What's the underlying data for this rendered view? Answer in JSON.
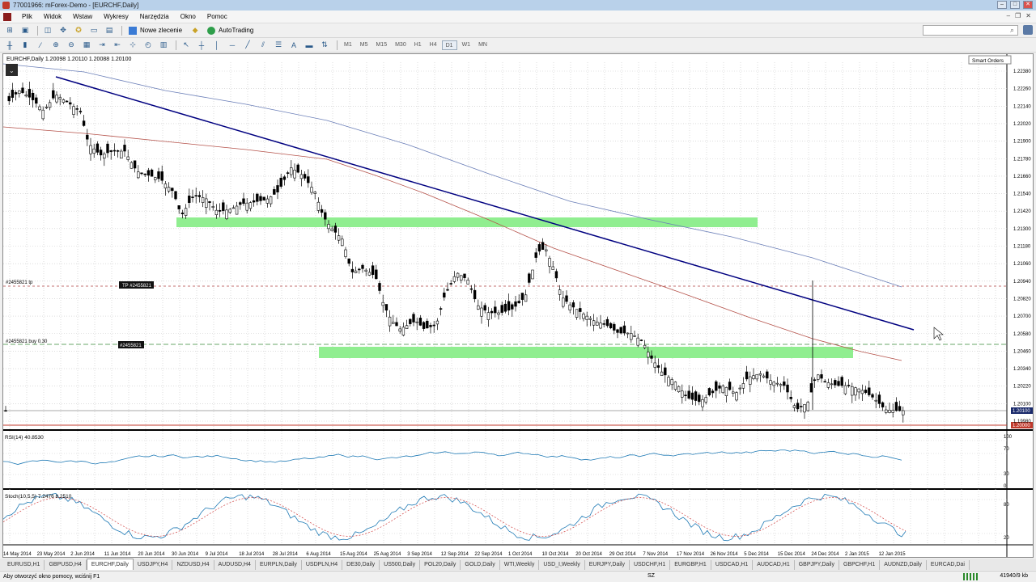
{
  "window": {
    "title": "77001966: mForex-Demo - [EURCHF,Daily]"
  },
  "menu": {
    "items": [
      "Plik",
      "Widok",
      "Wstaw",
      "Wykresy",
      "Narzędzia",
      "Okno",
      "Pomoc"
    ]
  },
  "toolbar": {
    "new_order_label": "Nowe zlecenie",
    "autotrading_label": "AutoTrading"
  },
  "timeframes": [
    "M1",
    "M5",
    "M15",
    "M30",
    "H1",
    "H4",
    "D1",
    "W1",
    "MN"
  ],
  "active_timeframe": "D1",
  "chart": {
    "info": "EURCHF,Daily  1.20098 1.20110 1.20088 1.20100",
    "smart_orders": "Smart Orders",
    "price_labels": [
      "1.22380",
      "1.22260",
      "1.22140",
      "1.22020",
      "1.21900",
      "1.21780",
      "1.21660",
      "1.21540",
      "1.21420",
      "1.21300",
      "1.21180",
      "1.21060",
      "1.20940",
      "1.20820",
      "1.20700",
      "1.20580",
      "1.20460",
      "1.20340",
      "1.20220",
      "1.20100",
      "1.19980"
    ],
    "current_price": "1.20100",
    "red_price": "1.20000",
    "tp_line_label": "#2455821 tp",
    "tp_tag": "TP #2455821",
    "buy_line_label": "#2455821 buy 0.30",
    "buy_tag": "#2455821",
    "rsi_label": "RSI(14) 40.8530",
    "rsi_levels": [
      "100",
      "70",
      "30",
      "0"
    ],
    "stoch_label": "Stoch(10,5,5) 7.2476 8.2510",
    "stoch_levels": [
      "80",
      "20"
    ],
    "date_labels": [
      "14 May 2014",
      "23 May 2014",
      "2 Jun 2014",
      "11 Jun 2014",
      "20 Jun 2014",
      "30 Jun 2014",
      "9 Jul 2014",
      "18 Jul 2014",
      "28 Jul 2014",
      "6 Aug 2014",
      "15 Aug 2014",
      "25 Aug 2014",
      "3 Sep 2014",
      "12 Sep 2014",
      "22 Sep 2014",
      "1 Oct 2014",
      "10 Oct 2014",
      "20 Oct 2014",
      "29 Oct 2014",
      "7 Nov 2014",
      "17 Nov 2014",
      "26 Nov 2014",
      "5 Dec 2014",
      "15 Dec 2014",
      "24 Dec 2014",
      "2 Jan 2015",
      "12 Jan 2015"
    ]
  },
  "tabs": [
    "EURUSD,H1",
    "GBPUSD,H4",
    "EURCHF,Daily",
    "USDJPY,H4",
    "NZDUSD,H4",
    "AUDUSD,H4",
    "EURPLN,Daily",
    "USDPLN,H4",
    "DE30,Daily",
    "US500,Daily",
    "POL20,Daily",
    "GOLD,Daily",
    "WTI,Weekly",
    "USD_I,Weekly",
    "EURJPY,Daily",
    "USDCHF,H1",
    "EURGBP,H1",
    "USDCAD,H1",
    "AUDCAD,H1",
    "GBPJPY,Daily",
    "GBPCHF,H1",
    "AUDNZD,Daily",
    "EURCAD,Dai"
  ],
  "active_tab": "EURCHF,Daily",
  "status": {
    "help": "Aby otworzyć okno pomocy, wciśnij F1",
    "profile": "SZ",
    "traffic": "41940/9 kb"
  },
  "colors": {
    "zone": "#90ee90",
    "trendline": "#000080",
    "ma_blue": "#6b7fb8",
    "ma_red": "#b5524a",
    "indicator": "#1f7ab5",
    "signal": "#d04040"
  }
}
